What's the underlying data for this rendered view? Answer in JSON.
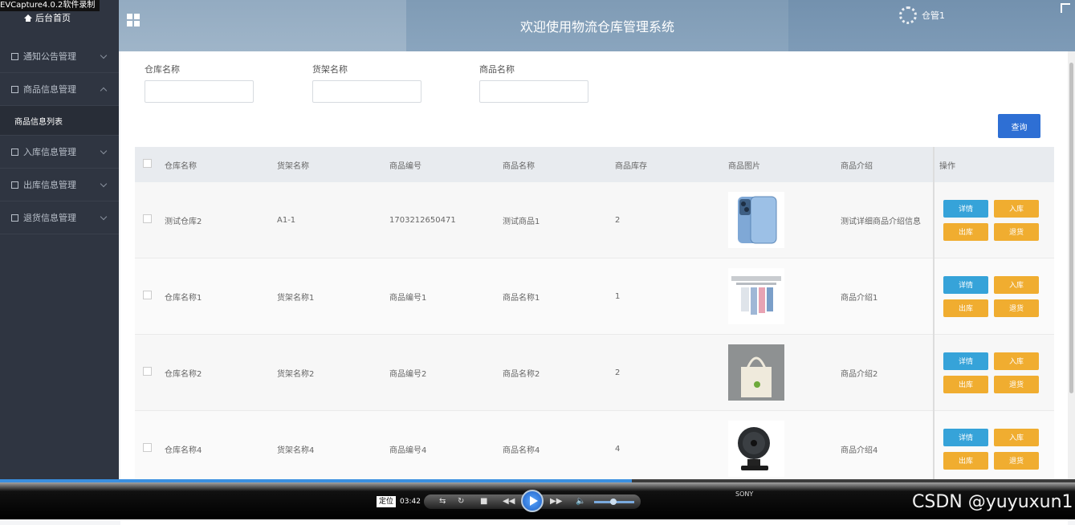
{
  "recorder_title": "EVCapture4.0.2软件录制",
  "sidebar": {
    "home": "后台首页",
    "items": [
      {
        "label": "通知公告管理",
        "expanded": false
      },
      {
        "label": "商品信息管理",
        "expanded": true,
        "children": [
          "商品信息列表"
        ]
      },
      {
        "label": "入库信息管理",
        "expanded": false
      },
      {
        "label": "出库信息管理",
        "expanded": false
      },
      {
        "label": "退货信息管理",
        "expanded": false
      }
    ]
  },
  "header": {
    "title": "欢迎使用物流仓库管理系统",
    "user": "仓管1"
  },
  "search": {
    "fields": [
      {
        "label": "仓库名称",
        "value": ""
      },
      {
        "label": "货架名称",
        "value": ""
      },
      {
        "label": "商品名称",
        "value": ""
      }
    ],
    "query_label": "查询"
  },
  "table": {
    "columns": [
      "仓库名称",
      "货架名称",
      "商品编号",
      "商品名称",
      "商品库存",
      "商品图片",
      "商品介绍",
      "操作"
    ],
    "rows": [
      {
        "warehouse": "测试仓库2",
        "shelf": "A1-1",
        "code": "1703212650471",
        "name": "测试商品1",
        "stock": "2",
        "image": "phone",
        "intro": "测试详细商品介绍信息"
      },
      {
        "warehouse": "仓库名称1",
        "shelf": "货架名称1",
        "code": "商品编号1",
        "name": "商品名称1",
        "stock": "1",
        "image": "clothes-rack",
        "intro": "商品介绍1"
      },
      {
        "warehouse": "仓库名称2",
        "shelf": "货架名称2",
        "code": "商品编号2",
        "name": "商品名称2",
        "stock": "2",
        "image": "tote-bag",
        "intro": "商品介绍2"
      },
      {
        "warehouse": "仓库名称4",
        "shelf": "货架名称4",
        "code": "商品编号4",
        "name": "商品名称4",
        "stock": "4",
        "image": "desk-fan",
        "intro": "商品介绍4"
      }
    ],
    "actions": {
      "detail": "详情",
      "in": "入库",
      "out": "出库",
      "return": "退货"
    }
  },
  "player": {
    "locate_label": "定位",
    "time": "03:42",
    "progress": 0.588,
    "partial_image_text": "SONY"
  },
  "watermark": "CSDN @yuyuxun1",
  "colors": {
    "sidebar": "#2f3541",
    "primary": "#2e6fd4",
    "detail": "#36a3d9",
    "warning": "#f0ad30"
  }
}
